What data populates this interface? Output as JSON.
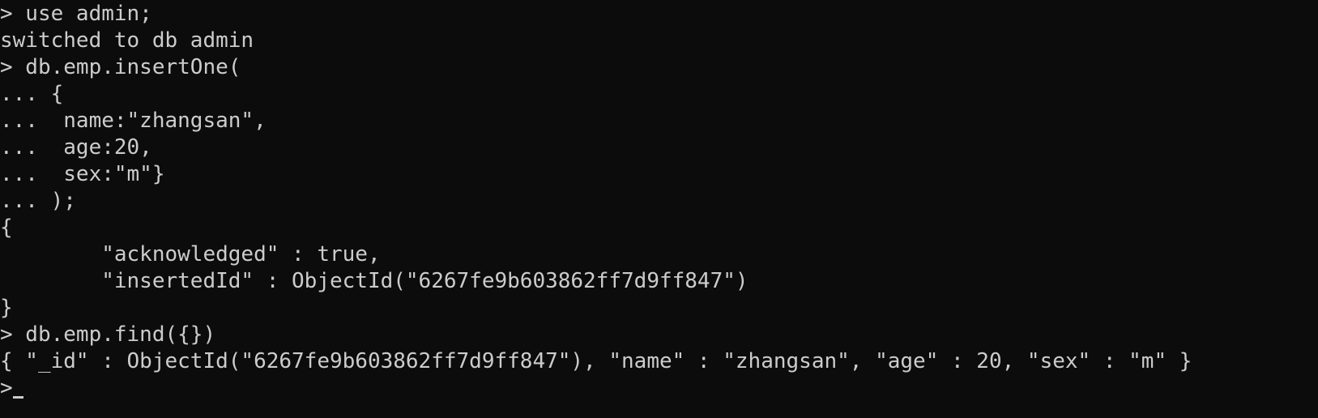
{
  "terminal": {
    "lines": [
      "> use admin;",
      "switched to db admin",
      "> db.emp.insertOne(",
      "... {",
      "...  name:\"zhangsan\",",
      "...  age:20,",
      "...  sex:\"m\"}",
      "... );",
      "{",
      "        \"acknowledged\" : true,",
      "        \"insertedId\" : ObjectId(\"6267fe9b603862ff7d9ff847\")",
      "}",
      "> db.emp.find({})",
      "{ \"_id\" : ObjectId(\"6267fe9b603862ff7d9ff847\"), \"name\" : \"zhangsan\", \"age\" : 20, \"sex\" : \"m\" }",
      ">"
    ],
    "colors": {
      "background": "#0c0c0c",
      "foreground": "#cccccc"
    }
  }
}
